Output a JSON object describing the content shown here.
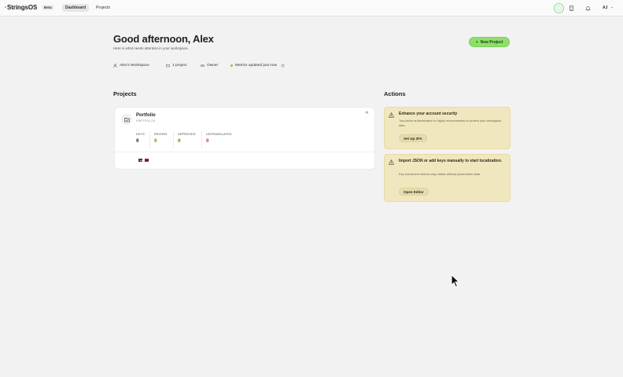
{
  "app": {
    "name": "StringsOS",
    "badge": "Beta"
  },
  "nav": {
    "tabs": [
      {
        "label": "Dashboard",
        "active": true
      },
      {
        "label": "Projects",
        "active": false
      }
    ],
    "user_initials": "AJ"
  },
  "header": {
    "greeting": "Good afternoon, Alex",
    "subtitle": "Here is what needs attention in your workspace.",
    "new_project_label": "New Project",
    "meta": {
      "workspace": "Alex's Workspace",
      "project_count": "1 project",
      "role": "Owner",
      "metrics_status": "Metrics updated just now"
    }
  },
  "projects": {
    "section_title": "Projects",
    "items": [
      {
        "name": "Portfolio",
        "slug": "PORTFOLIO",
        "stats": [
          {
            "label": "KEYS",
            "value": "0"
          },
          {
            "label": "REVIEW",
            "value": "0"
          },
          {
            "label": "APPROVED",
            "value": "0"
          },
          {
            "label": "UNTRANSLATED",
            "value": "0"
          }
        ],
        "flag_icons": [
          "us-flag-icon",
          "uk-flag-icon"
        ]
      }
    ]
  },
  "actions": {
    "section_title": "Actions",
    "items": [
      {
        "title": "Enhance your account security",
        "description": "Two-factor authentication is highly recommended to protect your workspace data.",
        "button_label": "Set Up 2FA"
      },
      {
        "title": "Import JSON or add keys manually to start localization.",
        "description": "Key movement metrics stay visible without placeholder data.",
        "button_label": "Open Editor"
      }
    ]
  },
  "colors": {
    "accent": "#8ee06a",
    "warning_bg": "#f1e7be",
    "background": "#f2f2f2"
  }
}
